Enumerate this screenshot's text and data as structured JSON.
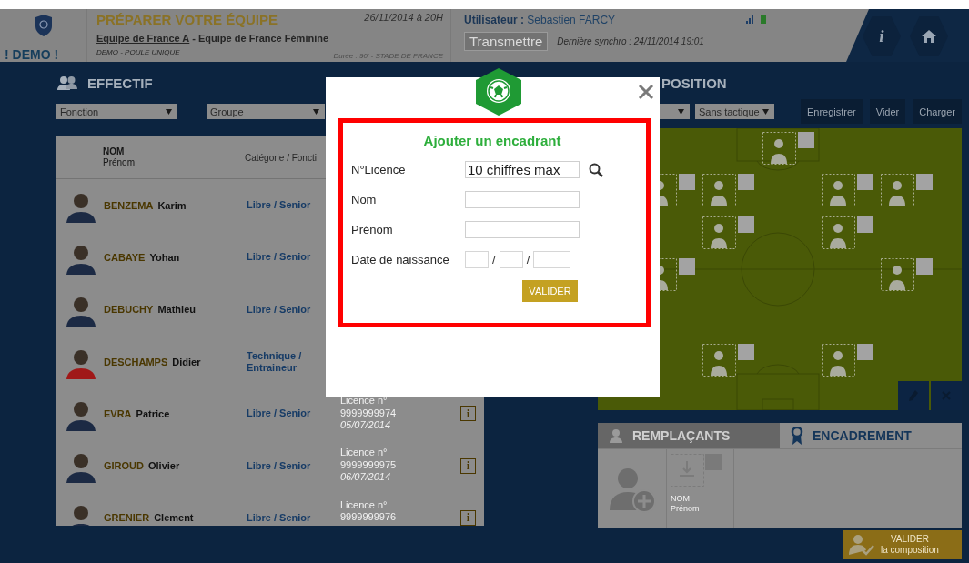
{
  "header": {
    "demo_label": "! DEMO !",
    "title": "PRÉPARER VOTRE ÉQUIPE",
    "team_link": "Equipe de France A",
    "team_rest": "- Equipe de France Féminine",
    "competition": "DEMO - POULE UNIQUE",
    "date": "26/11/2014 à 20H",
    "venue": "Durée : 90' - STADE DE FRANCE",
    "user": "**Utilisateur :** Sebastien FARCY",
    "transmit_button": {
      "label": "Transmettre",
      "disabled": true
    },
    "sync": "Dernière synchro : 24/11/2014 19:01",
    "info_button": "i"
  },
  "effectif": {
    "title": "EFFECTIF",
    "filters": [
      "Fonction",
      "Groupe"
    ],
    "columns": {
      "name": "NOM",
      "first_name": "Prénom",
      "category": "Catégorie / Foncti"
    },
    "rows": [
      {
        "last": "BENZEMA",
        "first": "Karim",
        "category": "Libre / Senior"
      },
      {
        "last": "CABAYE",
        "first": "Yohan",
        "category": "Libre / Senior"
      },
      {
        "last": "DEBUCHY",
        "first": "Mathieu",
        "category": "Libre / Senior"
      },
      {
        "last": "DESCHAMPS",
        "first": "Didier",
        "category": "Technique / Entraineur"
      },
      {
        "last": "EVRA",
        "first": "Patrice",
        "category": "Libre / Senior",
        "licence": [
          "Licence n°",
          "9999999974",
          "05/07/2014"
        ],
        "info": "i"
      },
      {
        "last": "GIROUD",
        "first": "Olivier",
        "category": "Libre / Senior",
        "licence": [
          "Licence n°",
          "9999999975",
          "06/07/2014"
        ],
        "info": "i"
      },
      {
        "last": "GRENIER",
        "first": "Clement",
        "category": "Libre / Senior",
        "licence": [
          "Licence n°",
          "9999999976"
        ],
        "info": "i"
      }
    ]
  },
  "composition": {
    "title": "POSITION",
    "tactic": "Sans tactique",
    "buttons": [
      "Enregistrer",
      "Vider",
      "Charger"
    ],
    "tabs": [
      {
        "label": "REMPLAÇANTS",
        "selected": false
      },
      {
        "label": "ENCADREMENT",
        "selected": true
      }
    ],
    "staff_slot": {
      "name": "NOM",
      "first_name": "Prénom"
    },
    "validate": {
      "label": "VALIDER",
      "sub": "la composition"
    }
  },
  "modal": {
    "title": "Ajouter un encadrant",
    "fields": [
      {
        "label": "N°Licence",
        "kind": "text",
        "value": "10 chiffres max",
        "search": true
      },
      {
        "label": "Nom",
        "kind": "text"
      },
      {
        "label": "Prénom",
        "kind": "text"
      },
      {
        "label": "Date de naissance",
        "kind": "date",
        "separator": "/"
      }
    ],
    "submit": "VALIDER"
  }
}
